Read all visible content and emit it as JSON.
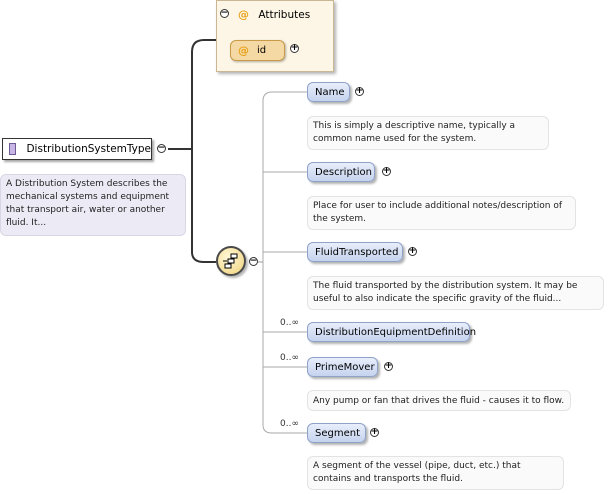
{
  "root": {
    "name": "DistributionSystemType",
    "doc": "A Distribution System describes the mechanical systems and equipment that transport air, water or another fluid. It..."
  },
  "attributes": {
    "title": "Attributes",
    "at_symbol": "@",
    "items": [
      {
        "name": "id"
      }
    ]
  },
  "toggles": {
    "collapse": "−",
    "expand": "+"
  },
  "elements": [
    {
      "name": "Name",
      "card": "",
      "doc": "This is simply a descriptive name, typically a common name used for the system."
    },
    {
      "name": "Description",
      "card": "",
      "doc": "Place for user to include additional notes/description of the system."
    },
    {
      "name": "FluidTransported",
      "card": "",
      "doc": "The fluid transported by the distribution system. It may be useful to also indicate the specific gravity of the fluid..."
    },
    {
      "name": "DistributionEquipmentDefinition",
      "card": "0..∞",
      "doc": ""
    },
    {
      "name": "PrimeMover",
      "card": "0..∞",
      "doc": "Any pump or fan that drives the fluid - causes it to flow."
    },
    {
      "name": "Segment",
      "card": "0..∞",
      "doc": "A segment of the vessel (pipe, duct, etc.) that contains and transports the fluid."
    }
  ],
  "colors": {
    "element_fill": "#c5d3ee",
    "attribute_fill": "#f5d9a5",
    "compositor_fill": "#f0d27a",
    "type_icon": "#c9b5e6"
  }
}
